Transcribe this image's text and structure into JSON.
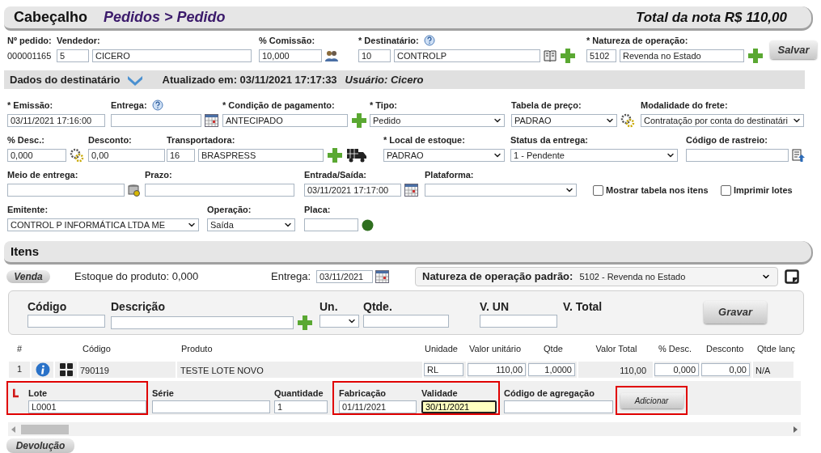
{
  "header": {
    "title": "Cabeçalho",
    "breadcrumb": "Pedidos > Pedido",
    "total": "Total da nota R$ 110,00"
  },
  "order": {
    "fields": [
      {
        "kind": "static",
        "label": "Nº pedido:",
        "value": "000001165"
      },
      {
        "kind": "input",
        "label": "Vendedor:",
        "code": "5",
        "value": "CICERO"
      },
      {
        "kind": "input",
        "label": "% Comissão:",
        "value": "10,000"
      },
      {
        "kind": "input",
        "label": "* Destinatário:",
        "code": "10",
        "value": "CONTROLP"
      },
      {
        "kind": "input",
        "label": "* Natureza de operação:",
        "code": "5102",
        "value": "Revenda no Estado"
      }
    ],
    "save": "Salvar"
  },
  "recipient_bar": {
    "title": "Dados do destinatário",
    "updated": "Atualizado em: 03/11/2021 17:17:33",
    "user": "Usuário: Cicero"
  },
  "form_rows": [
    [
      {
        "kind": "input",
        "label": "* Emissão:",
        "value": "03/11/2021 17:16:00"
      },
      {
        "kind": "input",
        "label": "Entrega:"
      },
      {
        "kind": "input",
        "label": "* Condição de pagamento:",
        "value": "ANTECIPADO"
      },
      {
        "kind": "select",
        "label": "* Tipo:",
        "value": "Pedido"
      },
      {
        "kind": "select",
        "label": "Tabela de preço:",
        "value": "PADRAO"
      },
      {
        "kind": "select",
        "label": "Modalidade do frete:",
        "value": "Contratação por conta do destinatári"
      }
    ],
    [
      {
        "kind": "input",
        "label": "% Desc.:",
        "value": "0,000"
      },
      {
        "kind": "input",
        "label": "Desconto:",
        "value": "0,00"
      },
      {
        "kind": "input",
        "label": "Transportadora:",
        "code": "16",
        "value": "BRASPRESS"
      },
      {
        "kind": "select",
        "label": "* Local de estoque:",
        "value": "PADRAO"
      },
      {
        "kind": "select",
        "label": "Status da entrega:",
        "value": "1 - Pendente"
      },
      {
        "kind": "input",
        "label": "Código de rastreio:"
      }
    ],
    [
      {
        "kind": "input",
        "label": "Meio de entrega:"
      },
      {
        "kind": "input",
        "label": "Prazo:"
      },
      {
        "kind": "input",
        "label": "Entrada/Saída:",
        "value": "03/11/2021 17:17:00"
      },
      {
        "kind": "select",
        "label": "Plataforma:"
      },
      {
        "kind": "checkbox",
        "label": "Mostrar tabela nos itens",
        "checked": false
      },
      {
        "kind": "checkbox",
        "label": "Imprimir lotes",
        "checked": false
      }
    ],
    [
      {
        "kind": "select",
        "label": "Emitente:",
        "value": "CONTROL P INFORMÁTICA LTDA ME"
      },
      {
        "kind": "select",
        "label": "Operação:",
        "value": "Saída"
      },
      {
        "kind": "input",
        "label": "Placa:"
      }
    ]
  ],
  "items": {
    "title": "Itens",
    "mode": "Venda",
    "stock": "Estoque do produto: 0,000",
    "delivery_label": "Entrega:",
    "delivery": "03/11/2021",
    "default_nature_label": "Natureza de operação padrão:",
    "default_nature": "5102 - Revenda no Estado",
    "entry": {
      "columns": [
        {
          "kind": "input",
          "label": "Código"
        },
        {
          "kind": "input",
          "label": "Descrição"
        },
        {
          "kind": "select",
          "label": "Un."
        },
        {
          "kind": "input",
          "label": "Qtde."
        },
        {
          "kind": "input",
          "label": "V. UN"
        },
        {
          "kind": "text",
          "label": "V. Total"
        }
      ],
      "save": "Gravar"
    },
    "table": {
      "columns": [
        "#",
        "Código",
        "Produto",
        "Unidade",
        "Valor unitário",
        "Qtde",
        "Valor Total",
        "% Desc.",
        "Desconto",
        "Qtde lanç"
      ],
      "rows": [
        {
          "number": "1",
          "code": "790119",
          "product": "TESTE LOTE NOVO",
          "unit": "RL",
          "unit_price": "110,00",
          "qty": "1,0000",
          "total": "110,00",
          "discount_pct": "0,000",
          "discount": "0,00",
          "posted_qty": "N/A"
        }
      ]
    },
    "lot_groups": [
      {
        "highlighted": true,
        "fields": [
          {
            "label": "Lote",
            "value": "L0001",
            "focused": false
          }
        ]
      },
      {
        "highlighted": false,
        "fields": [
          {
            "label": "Série",
            "focused": false
          },
          {
            "label": "Quantidade",
            "value": "1",
            "focused": false
          }
        ]
      },
      {
        "highlighted": true,
        "fields": [
          {
            "label": "Fabricação",
            "value": "01/11/2021",
            "focused": false
          },
          {
            "label": "Validade",
            "value": "30/11/2021",
            "focused": true
          }
        ]
      },
      {
        "highlighted": false,
        "fields": [
          {
            "label": "Código de agregação",
            "focused": false
          }
        ]
      },
      {
        "highlighted": true,
        "button": "Adicionar"
      }
    ]
  },
  "return_tab": "Devolução"
}
